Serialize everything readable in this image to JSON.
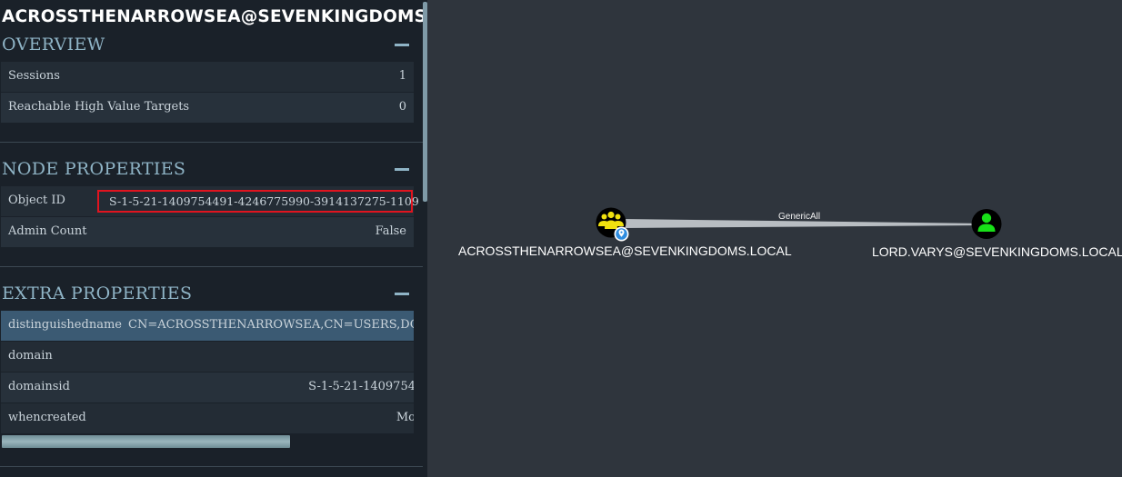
{
  "panel": {
    "title": "ACROSSTHENARROWSEA@SEVENKINGDOMS.LOCAL",
    "overview": {
      "header": "OVERVIEW",
      "rows": [
        {
          "key": "Sessions",
          "value": "1"
        },
        {
          "key": "Reachable High Value Targets",
          "value": "0"
        }
      ]
    },
    "node_properties": {
      "header": "NODE PROPERTIES",
      "object_id_label": "Object ID",
      "object_id_value": "S-1-5-21-1409754491-4246775990-3914137275-1109",
      "admin_count_label": "Admin Count",
      "admin_count_value": "False"
    },
    "extra_properties": {
      "header": "EXTRA PROPERTIES",
      "rows": [
        {
          "key": "distinguishedname",
          "value": "CN=ACROSSTHENARROWSEA,CN=USERS,DC=S"
        },
        {
          "key": "domain",
          "value": ""
        },
        {
          "key": "domainsid",
          "value": "S-1-5-21-1409754"
        },
        {
          "key": "whencreated",
          "value": "Mo"
        }
      ]
    }
  },
  "graph": {
    "source_node": {
      "label": "ACROSSTHENARROWSEA@SEVENKINGDOMS.LOCAL",
      "type": "group",
      "color": "#f0e10f"
    },
    "target_node": {
      "label": "LORD.VARYS@SEVENKINGDOMS.LOCAL",
      "type": "user",
      "color": "#18e018"
    },
    "edge_label": "GenericAll"
  },
  "colors": {
    "panel_bg": "#1a2129",
    "graph_bg": "#2f353d",
    "accent": "#8fb4c6",
    "highlight_box": "#e0141f"
  }
}
